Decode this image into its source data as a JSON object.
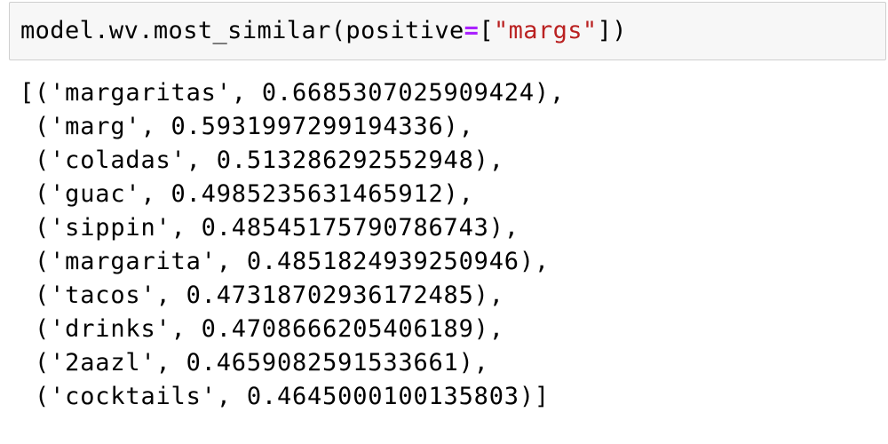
{
  "input_cell": {
    "code_prefix": "model.wv.most_similar(positive",
    "code_eq": "=",
    "code_open": "[",
    "code_string": "\"margs\"",
    "code_close": "])"
  },
  "output_cell": {
    "lines": [
      "[('margaritas', 0.6685307025909424),",
      " ('marg', 0.5931997299194336),",
      " ('coladas', 0.513286292552948),",
      " ('guac', 0.4985235631465912),",
      " ('sippin', 0.48545175790786743),",
      " ('margarita', 0.4851824939250946),",
      " ('tacos', 0.47318702936172485),",
      " ('drinks', 0.4708666205406189),",
      " ('2aazl', 0.4659082591533661),",
      " ('cocktails', 0.4645000100135803)]"
    ]
  },
  "colors": {
    "cell_background": "#f7f7f7",
    "cell_border": "#cfcfcf",
    "operator": "#aa22ff",
    "string": "#ba2121"
  }
}
